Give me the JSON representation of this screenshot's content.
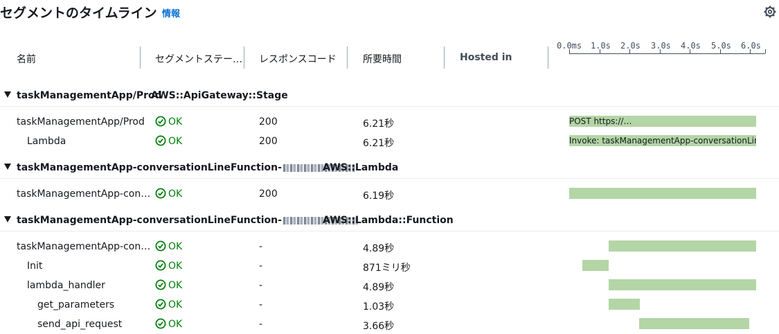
{
  "page": {
    "title": "セグメントのタイムライン",
    "info_link": "情報",
    "settings_icon": "gear-icon"
  },
  "columns": {
    "name": "名前",
    "segment_status": "セグメントステー…",
    "response_code": "レスポンスコード",
    "duration": "所要時間",
    "hosted_in": "Hosted in"
  },
  "axis": {
    "ticks": [
      "0.0ms",
      "1.0s",
      "2.0s",
      "3.0s",
      "4.0s",
      "5.0s",
      "6.0s"
    ]
  },
  "timeline_scale_max_seconds": 6.5,
  "groups": [
    {
      "name": "taskManagementApp/Prod",
      "type": "AWS::ApiGateway::Stage",
      "rows": [
        {
          "name": "taskManagementApp/Prod",
          "indent": 0,
          "status": "OK",
          "code": "200",
          "duration": "6.21秒",
          "start_s": 0.0,
          "dur_s": 6.21,
          "bar_label": "POST https://…"
        },
        {
          "name": "Lambda",
          "indent": 1,
          "status": "OK",
          "code": "200",
          "duration": "6.21秒",
          "start_s": 0.0,
          "dur_s": 6.21,
          "bar_label": "Invoke: taskManagementApp-conversationLineFu…"
        }
      ]
    },
    {
      "name": "taskManagementApp-conversationLineFunction-",
      "type": "AWS::Lambda",
      "rows": [
        {
          "name": "taskManagementApp-con…",
          "indent": 0,
          "status": "OK",
          "code": "200",
          "duration": "6.19秒",
          "start_s": 0.0,
          "dur_s": 6.19,
          "bar_label": ""
        }
      ]
    },
    {
      "name": "taskManagementApp-conversationLineFunction-",
      "type": "AWS::Lambda::Function",
      "rows": [
        {
          "name": "taskManagementApp-con…",
          "indent": 0,
          "status": "OK",
          "code": "-",
          "duration": "4.89秒",
          "start_s": 1.3,
          "dur_s": 4.89,
          "bar_label": ""
        },
        {
          "name": "Init",
          "indent": 1,
          "status": "OK",
          "code": "-",
          "duration": "871ミリ秒",
          "start_s": 0.43,
          "dur_s": 0.871,
          "bar_label": ""
        },
        {
          "name": "lambda_handler",
          "indent": 1,
          "status": "OK",
          "code": "-",
          "duration": "4.89秒",
          "start_s": 1.3,
          "dur_s": 4.89,
          "bar_label": ""
        },
        {
          "name": "get_parameters",
          "indent": 2,
          "status": "OK",
          "code": "-",
          "duration": "1.03秒",
          "start_s": 1.3,
          "dur_s": 1.03,
          "bar_label": ""
        },
        {
          "name": "send_api_request",
          "indent": 2,
          "status": "OK",
          "code": "-",
          "duration": "3.66秒",
          "start_s": 2.33,
          "dur_s": 3.66,
          "bar_label": ""
        }
      ]
    }
  ]
}
